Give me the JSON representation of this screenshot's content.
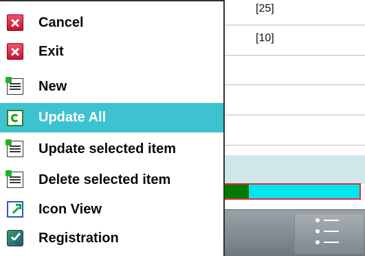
{
  "background_list": {
    "row1_value": "[25]",
    "row2_value": "[10]",
    "progress_fraction": 0.2
  },
  "menu": {
    "items": [
      {
        "label": "Cancel",
        "icon": "close-icon",
        "selected": false
      },
      {
        "label": "Exit",
        "icon": "close-icon",
        "selected": false
      },
      {
        "label": "New",
        "icon": "form-icon",
        "selected": false
      },
      {
        "label": "Update All",
        "icon": "refresh-icon",
        "selected": true
      },
      {
        "label": "Update selected item",
        "icon": "form-icon",
        "selected": false
      },
      {
        "label": "Delete selected item",
        "icon": "form-icon",
        "selected": false
      },
      {
        "label": "Icon View",
        "icon": "icon-view-icon",
        "selected": false
      },
      {
        "label": "Registration",
        "icon": "registration-icon",
        "selected": false
      }
    ]
  },
  "colors": {
    "selection": "#3dc2cf",
    "progress_border": "#e4283c",
    "progress_track": "#00e6f0",
    "progress_fill": "#007a00"
  },
  "bottom_bar": {
    "list_view_button_icon": "list-view-icon"
  }
}
